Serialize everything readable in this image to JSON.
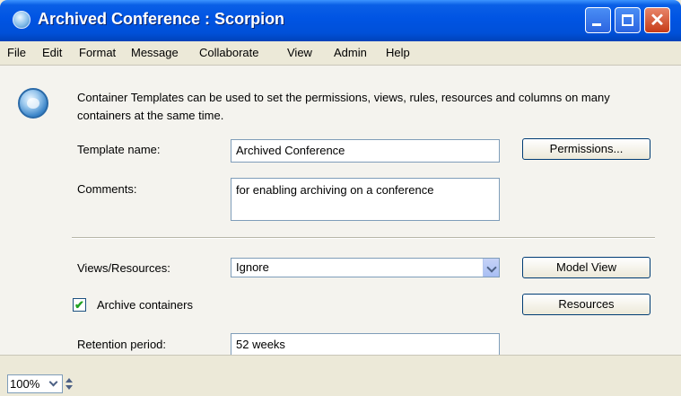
{
  "window": {
    "title": "Archived Conference : Scorpion"
  },
  "menu": [
    "File",
    "Edit",
    "Format",
    "Message",
    "Collaborate",
    "View",
    "Admin",
    "Help"
  ],
  "description": "Container Templates can be used to set the permissions, views, rules, resources and columns on many containers at the same time.",
  "form": {
    "template_name_label": "Template name:",
    "template_name_value": "Archived Conference",
    "comments_label": "Comments:",
    "comments_value": "for enabling archiving on a conference",
    "views_label": "Views/Resources:",
    "views_value": "Ignore",
    "archive_label": "Archive containers",
    "archive_checked": true,
    "retention_label": "Retention period:",
    "retention_value": "52 weeks"
  },
  "buttons": {
    "permissions": "Permissions...",
    "model_view": "Model View",
    "resources": "Resources"
  },
  "status": {
    "zoom": "100%"
  },
  "icons": {
    "app": "globe-icon",
    "info": "globe-icon",
    "minimize": "minimize-icon",
    "maximize": "maximize-icon",
    "close": "close-icon",
    "dropdown": "chevron-down-icon",
    "spinner": "spinner-arrows-icon",
    "check": "checkmark-icon"
  },
  "colors": {
    "titlebar": "#0054e3",
    "close": "#c63b17",
    "check": "#21a121"
  }
}
